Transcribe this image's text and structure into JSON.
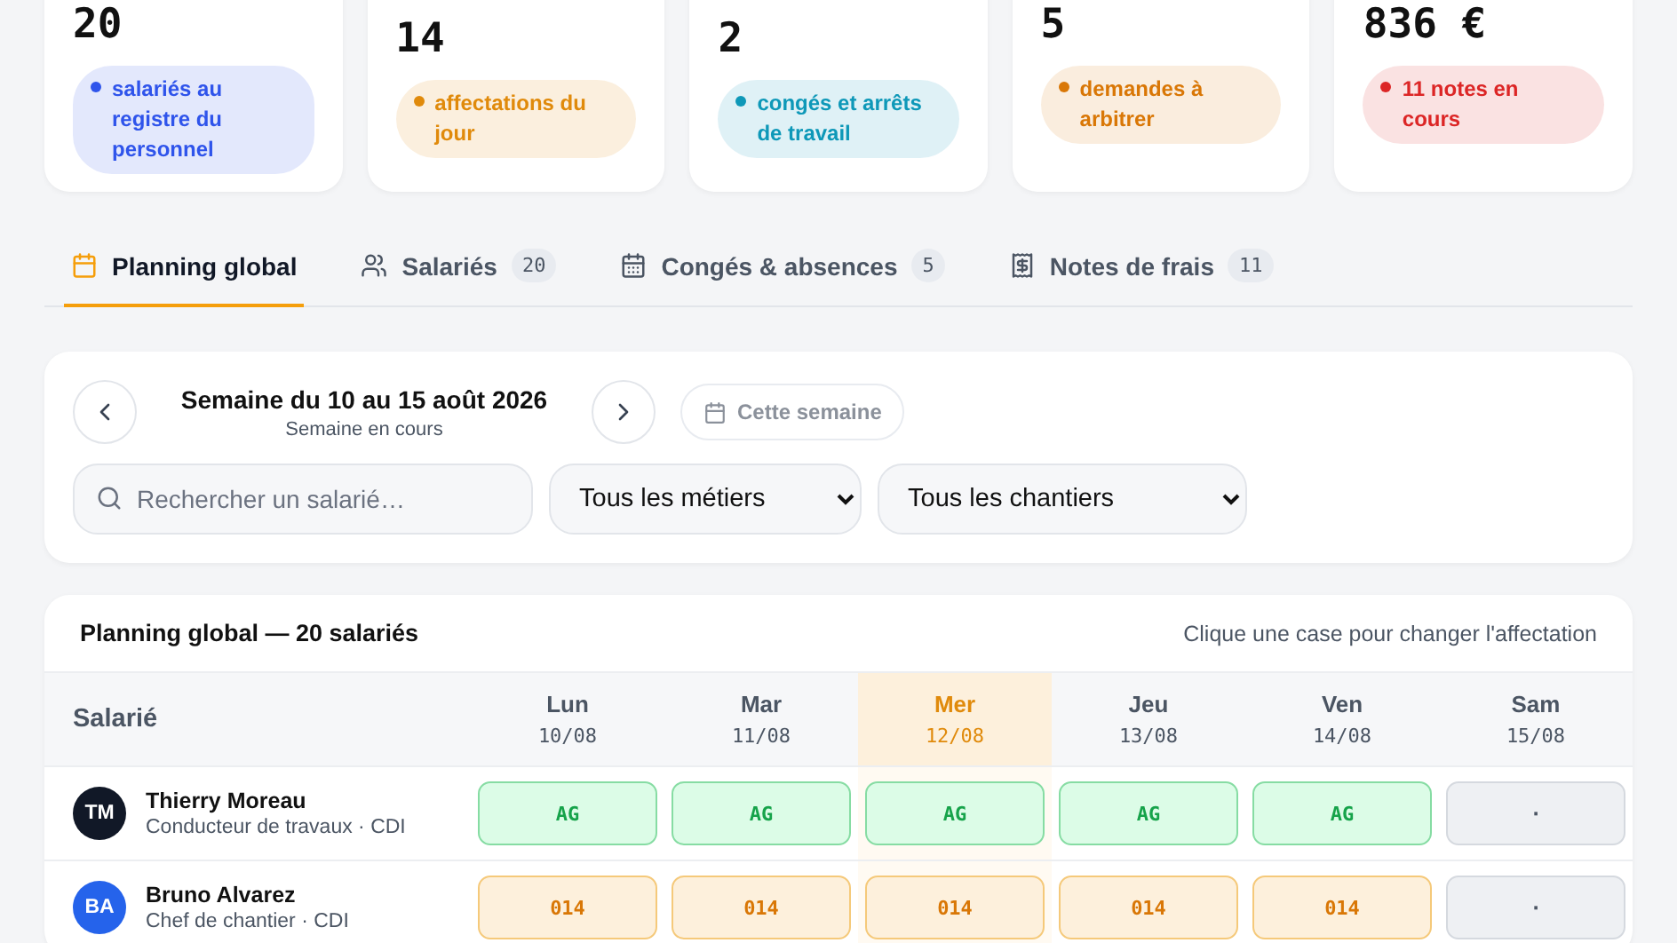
{
  "stats": [
    {
      "value": "20",
      "label": "salariés au registre du personnel",
      "color": "#2f54eb"
    },
    {
      "value": "14",
      "label": "affectations du jour",
      "color": "#e08a0b"
    },
    {
      "value": "2",
      "label": "congés et arrêts de travail",
      "color": "#0e98b8"
    },
    {
      "value": "5",
      "label": "demandes à arbitrer",
      "color": "#d97706"
    },
    {
      "value": "836 €",
      "label": "11 notes en cours",
      "color": "#dc2626"
    }
  ],
  "tabs": [
    {
      "label": "Planning global",
      "selected": true
    },
    {
      "label": "Salariés",
      "count": "20",
      "selected": false
    },
    {
      "label": "Congés & absences",
      "count": "5",
      "selected": false
    },
    {
      "label": "Notes de frais",
      "count": "11",
      "selected": false
    }
  ],
  "week": {
    "title": "Semaine du 10 au 15 août 2026",
    "subtitle": "Semaine en cours",
    "today_button": "Cette semaine"
  },
  "filters": {
    "search_placeholder": "Rechercher un salarié…",
    "selects": [
      "Tous les métiers",
      "Tous les chantiers"
    ]
  },
  "planning": {
    "title": "Planning global — 20 salariés",
    "hint": "Clique une case pour changer l'affectation",
    "first_column": "Salarié",
    "days": [
      {
        "day": "Lun",
        "date": "10/08",
        "selected": false
      },
      {
        "day": "Mar",
        "date": "11/08",
        "selected": false
      },
      {
        "day": "Mer",
        "date": "12/08",
        "selected": true
      },
      {
        "day": "Jeu",
        "date": "13/08",
        "selected": false
      },
      {
        "day": "Ven",
        "date": "14/08",
        "selected": false
      },
      {
        "day": "Sam",
        "date": "15/08",
        "selected": false
      }
    ],
    "rows": [
      {
        "initials": "TM",
        "color": "#111827",
        "name": "Thierry Moreau",
        "role": "Conducteur de travaux · CDI",
        "cells": [
          {
            "kind": "assigned",
            "text": "AG"
          },
          {
            "kind": "assigned",
            "text": "AG"
          },
          {
            "kind": "assigned",
            "text": "AG"
          },
          {
            "kind": "assigned",
            "text": "AG"
          },
          {
            "kind": "assigned",
            "text": "AG"
          },
          {
            "kind": "empty",
            "text": "·"
          }
        ]
      },
      {
        "initials": "BA",
        "color": "#2563eb",
        "name": "Bruno Alvarez",
        "role": "Chef de chantier · CDI",
        "cells": [
          {
            "kind": "site",
            "text": "014"
          },
          {
            "kind": "site",
            "text": "014"
          },
          {
            "kind": "site",
            "text": "014"
          },
          {
            "kind": "site",
            "text": "014"
          },
          {
            "kind": "site",
            "text": "014"
          },
          {
            "kind": "empty",
            "text": "·"
          }
        ]
      }
    ]
  }
}
